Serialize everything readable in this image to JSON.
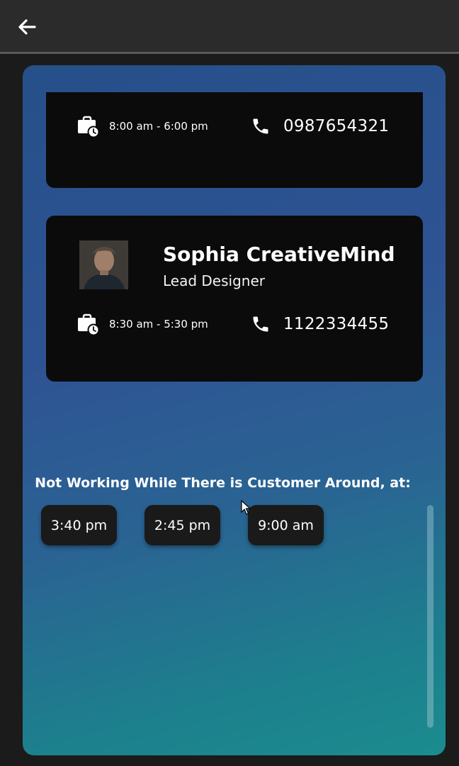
{
  "icons": {
    "back": "arrow-left-icon",
    "hours": "briefcase-clock-icon",
    "phone": "phone-icon"
  },
  "cards": [
    {
      "hours": "8:00 am - 6:00 pm",
      "phone": "0987654321"
    },
    {
      "name": "Sophia CreativeMind",
      "role": "Lead Designer",
      "hours": "8:30 am - 5:30 pm",
      "phone": "1122334455"
    }
  ],
  "section": {
    "title": "Not Working While There is Customer Around, at:",
    "times": [
      "3:40 pm",
      "2:45 pm",
      "9:00 am"
    ]
  },
  "colors": {
    "topbar": "#2b2b2b",
    "card": "#0b0b0b",
    "gradient_start": "#26508a",
    "gradient_end": "#1b8c8e"
  }
}
